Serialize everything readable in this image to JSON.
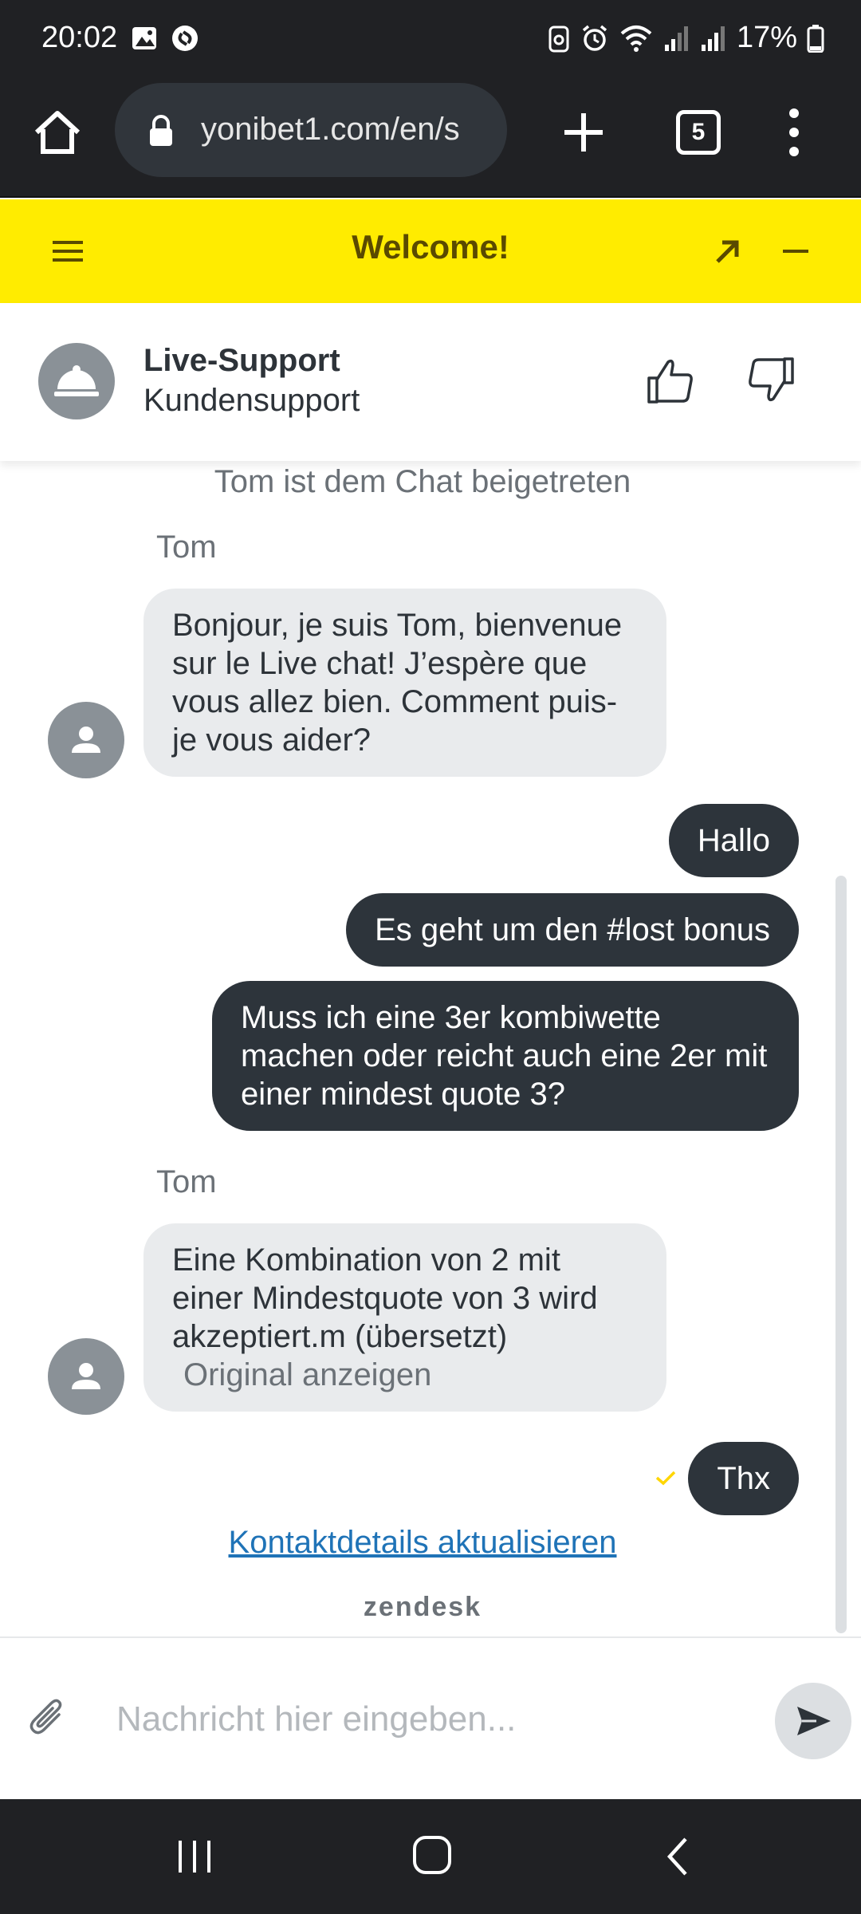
{
  "status_bar": {
    "time": "20:02",
    "battery": "17%",
    "icons": [
      "image-icon",
      "shazam-icon",
      "battery-saver-icon",
      "alarm-icon",
      "wifi-icon",
      "signal-icon",
      "signal-icon",
      "battery-icon"
    ]
  },
  "browser": {
    "url": "yonibet1.com/en/s",
    "tab_count": "5"
  },
  "widget": {
    "title": "Welcome!",
    "accent_color": "#ffec00"
  },
  "support": {
    "name": "Live-Support",
    "subtitle": "Kundensupport"
  },
  "chat": {
    "system_message": "Tom ist dem Chat beigetreten",
    "agent_name_1": "Tom",
    "agent_message_1": "Bonjour, je suis Tom, bienvenue sur le Live chat! J’espère que vous allez bien. Comment puis-je vous aider?",
    "user_message_1": "Hallo",
    "user_message_2": "Es geht um den #lost bonus",
    "user_message_3": "Muss ich eine 3er kombiwette machen oder reicht auch eine 2er mit einer mindest quote 3?",
    "agent_name_2": "Tom",
    "agent_message_2": "Eine Kombination von 2 mit einer Mindestquote von 3 wird akzeptiert.m (übersetzt)",
    "show_original": "Original anzeigen",
    "user_message_4": "Thx",
    "contact_link": "Kontaktdetails aktualisieren",
    "branding": "zendesk"
  },
  "composer": {
    "placeholder": "Nachricht hier eingeben..."
  }
}
